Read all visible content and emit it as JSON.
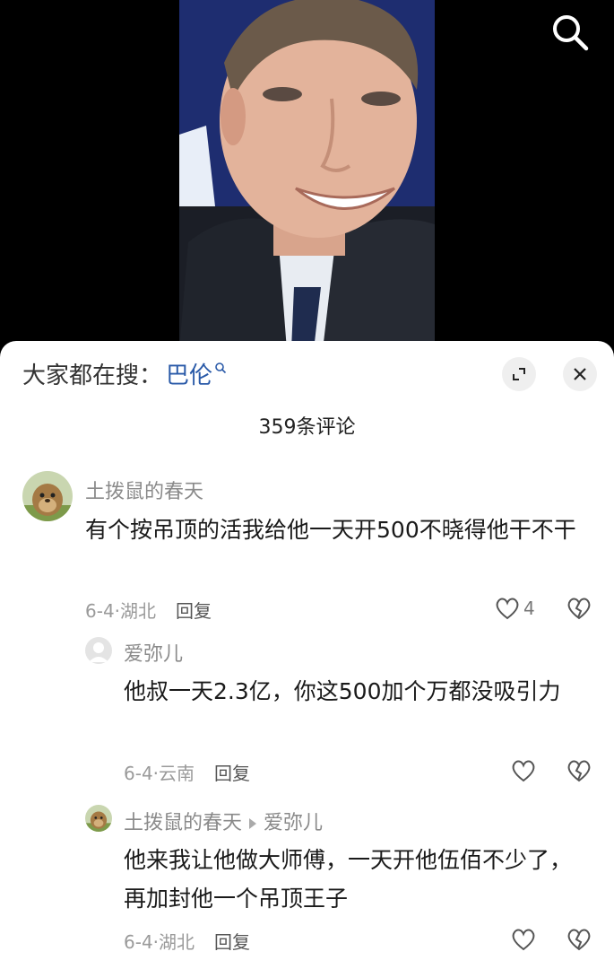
{
  "search_suggest": {
    "prefix": "大家都在搜：",
    "term": "巴伦"
  },
  "comment_count": "359条评论",
  "comments": [
    {
      "author": "土拨鼠的春天",
      "text": "有个按吊顶的活我给他一天开500不晓得他干不干",
      "date_location": "6-4·湖北",
      "reply_label": "回复",
      "likes": "4"
    }
  ],
  "replies": [
    {
      "author": "爱弥儿",
      "text": "他叔一天2.3亿，你这500加个万都没吸引力",
      "date_location": "6-4·云南",
      "reply_label": "回复"
    },
    {
      "author": "土拨鼠的春天",
      "reply_to": "爱弥儿",
      "text": "他来我让他做大师傅，一天开他伍佰不少了，再加封他一个吊顶王子",
      "date_location": "6-4·湖北",
      "reply_label": "回复"
    }
  ],
  "colors": {
    "sheet_bg": "#ffffff",
    "link": "#2a5aa8",
    "muted": "#8a8a8a"
  }
}
